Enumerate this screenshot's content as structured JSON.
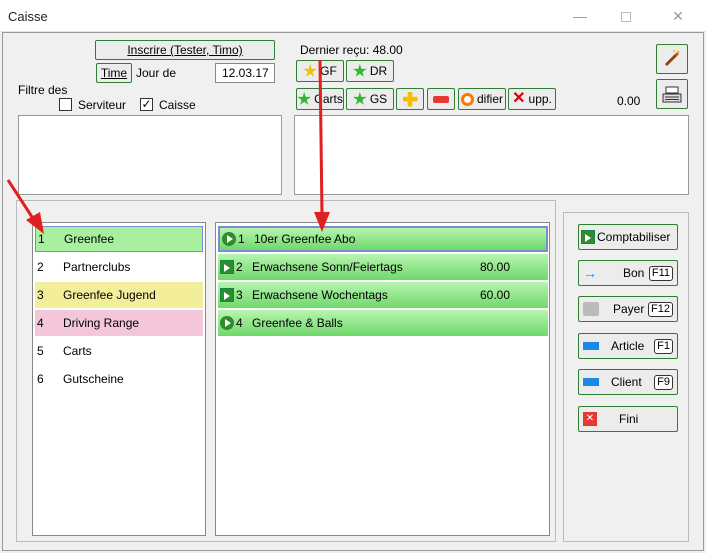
{
  "window": {
    "title": "Caisse",
    "minimize": "—",
    "close": "✕"
  },
  "header": {
    "inscrire_label": "Inscrire (Tester, Timo)",
    "time_button": "Time",
    "jour_de_label": "Jour de",
    "date_value": "12.03.17",
    "dernier_recu": "Dernier reçu: 48.00",
    "filtre_label": "Filtre des",
    "serviteur_label": "Serviteur",
    "caisse_label": "Caisse",
    "serviteur_checked": false,
    "caisse_checked": true,
    "total_value": "0.00"
  },
  "toolbar": {
    "gf": "GF",
    "dr": "DR",
    "carts": "Carts",
    "gs": "GS",
    "modifier": "difier",
    "supp": "upp."
  },
  "categories": [
    {
      "num": "1",
      "label": "Greenfee",
      "color": "#a8f0a0",
      "selected": true
    },
    {
      "num": "2",
      "label": "Partnerclubs",
      "color": "#ffffff"
    },
    {
      "num": "3",
      "label": "Greenfee Jugend",
      "color": "#f3ee9a"
    },
    {
      "num": "4",
      "label": "Driving Range",
      "color": "#f3c6da"
    },
    {
      "num": "5",
      "label": "Carts",
      "color": "#ffffff"
    },
    {
      "num": "6",
      "label": "Gutscheine",
      "color": "#ffffff"
    }
  ],
  "articles": [
    {
      "num": "1",
      "label": "10er Greenfee Abo",
      "price": "",
      "icon": "circle"
    },
    {
      "num": "2",
      "label": "Erwachsene Sonn/Feiertags",
      "price": "80.00",
      "icon": "box"
    },
    {
      "num": "3",
      "label": "Erwachsene Wochentags",
      "price": "60.00",
      "icon": "box"
    },
    {
      "num": "4",
      "label": "Greenfee & Balls",
      "price": "",
      "icon": "circle"
    }
  ],
  "side_buttons": {
    "comptabiliser": "Comptabiliser",
    "bon": "Bon",
    "bon_key": "F11",
    "payer": "Payer",
    "payer_key": "F12",
    "article": "Article",
    "article_key": "F1",
    "client": "Client",
    "client_key": "F9",
    "fini": "Fini"
  },
  "colors": {
    "accent_green": "#2e7d32",
    "selected_green": "#a8f0a0",
    "annotation_red": "#e02020"
  }
}
